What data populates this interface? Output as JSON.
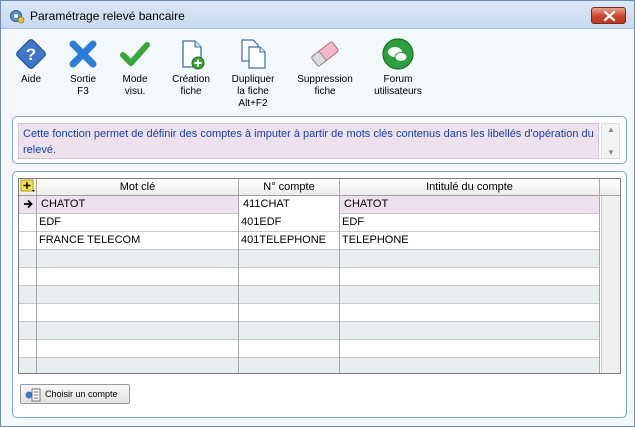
{
  "window": {
    "title": "Paramétrage relevé bancaire",
    "icon": "gear-icon"
  },
  "toolbar": {
    "items": [
      {
        "label": "Aide",
        "icon": "help-icon"
      },
      {
        "label": "Sortie\nF3",
        "icon": "exit-icon"
      },
      {
        "label": "Mode\nvisu.",
        "icon": "checkmark-icon"
      },
      {
        "label": "Création\nfiche",
        "icon": "new-document-icon"
      },
      {
        "label": "Dupliquer\nla fiche\nAlt+F2",
        "icon": "duplicate-icon"
      },
      {
        "label": "Suppression\nfiche",
        "icon": "eraser-icon"
      },
      {
        "label": "Forum\nutilisateurs",
        "icon": "forum-icon"
      }
    ]
  },
  "info": {
    "text": "Cette fonction permet de définir des comptes à imputer à partir de mots clés contenus dans les libellés d'opération du relevé."
  },
  "grid": {
    "columns": [
      "Mot clé",
      "N° compte",
      "Intitulé du compte"
    ],
    "rows": [
      {
        "keyword": "CHATOT",
        "account": "411CHAT",
        "label": "CHATOT"
      },
      {
        "keyword": "EDF",
        "account": "401EDF",
        "label": "EDF"
      },
      {
        "keyword": "FRANCE TELECOM",
        "account": "401TELEPHONE",
        "label": "TELEPHONE"
      }
    ],
    "empty_rows": 8
  },
  "footer": {
    "choose_account_label": "Choisir un compte"
  },
  "colors": {
    "info_text": "#1a3ea0",
    "selected_row": "#ece1ec",
    "alt_row": "#e8eef0"
  }
}
